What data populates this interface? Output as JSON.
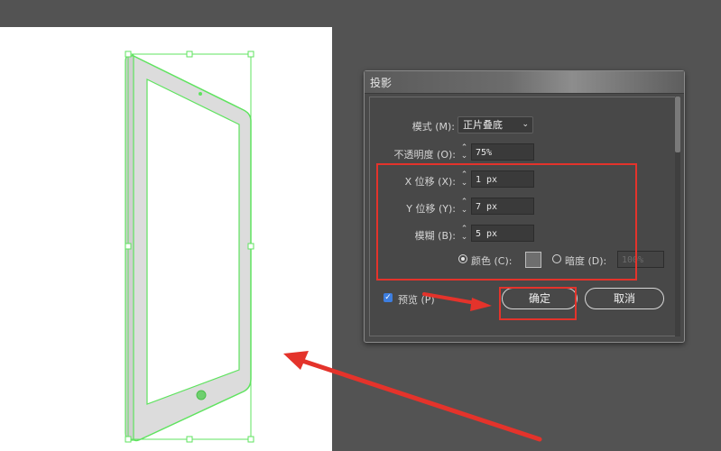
{
  "dialog": {
    "title": "投影",
    "mode": {
      "label": "模式 (M):",
      "value": "正片叠底"
    },
    "opacity": {
      "label": "不透明度 (O):",
      "value": "75%"
    },
    "x_offset": {
      "label": "X 位移 (X):",
      "value": "1 px"
    },
    "y_offset": {
      "label": "Y 位移 (Y):",
      "value": "7 px"
    },
    "blur": {
      "label": "模糊 (B):",
      "value": "5 px"
    },
    "color_option": {
      "label": "颜色 (C):",
      "selected": true,
      "swatch": "#6e6e6e"
    },
    "darkness_option": {
      "label": "暗度 (D):",
      "selected": false,
      "value": "100%"
    },
    "preview": {
      "label": "预览 (P)",
      "checked": true
    },
    "ok_label": "确定",
    "cancel_label": "取消"
  },
  "colors": {
    "accent_red": "#e4332b",
    "selection_green": "#5fe35f",
    "dialog_bg": "#4a4a4a",
    "workspace_bg": "#535353"
  }
}
